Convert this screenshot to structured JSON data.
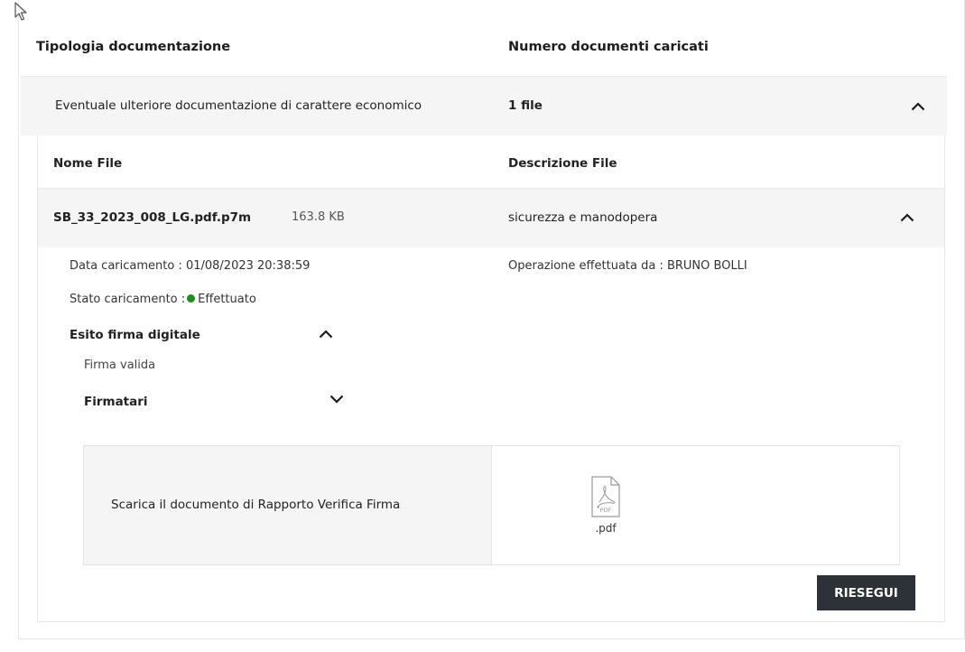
{
  "headers": {
    "tipologia": "Tipologia documentazione",
    "numero": "Numero documenti caricati"
  },
  "accordion": {
    "label": "Eventuale ulteriore documentazione di carattere economico",
    "count": "1 file"
  },
  "file_table": {
    "col_name": "Nome File",
    "col_desc": "Descrizione File"
  },
  "file": {
    "name": "SB_33_2023_008_LG.pdf.p7m",
    "size": "163.8 KB",
    "description": "sicurezza e manodopera",
    "upload_date": "Data caricamento : 01/08/2023 20:38:59",
    "operator": "Operazione effettuata da : BRUNO BOLLI",
    "status_label": "Stato caricamento :",
    "status_value": "Effettuato",
    "status_color": "#1a8f1a"
  },
  "signature": {
    "title": "Esito firma digitale",
    "result": "Firma valida",
    "signers_title": "Firmatari"
  },
  "report": {
    "label": "Scarica il documento di Rapporto Verifica Firma",
    "icon": "pdf-file-icon",
    "icon_text": "PDF",
    "extension": ".pdf"
  },
  "actions": {
    "rerun": "RIESEGUI"
  }
}
